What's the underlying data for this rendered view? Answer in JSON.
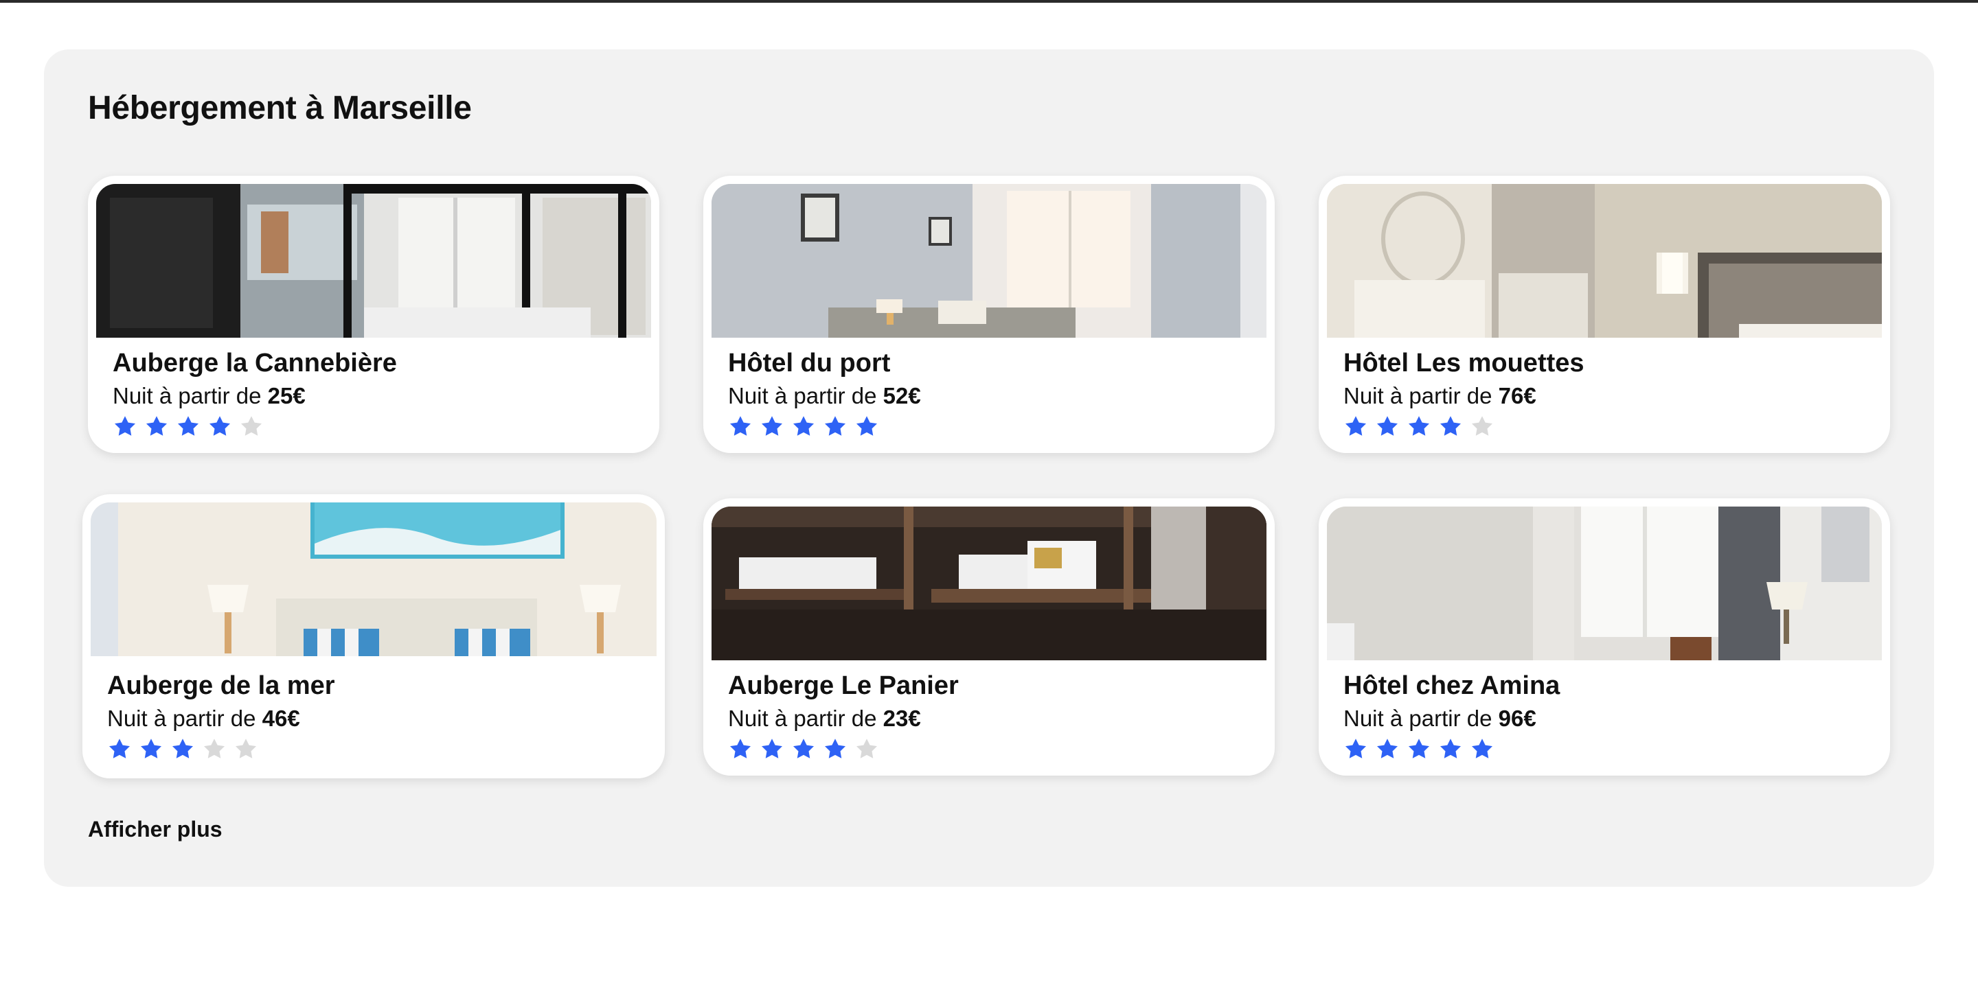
{
  "section": {
    "title": "Hébergement à Marseille",
    "more_label": "Afficher plus"
  },
  "listings": [
    {
      "name": "Auberge la Cannebière",
      "price_prefix": "Nuit à partir de",
      "price": "25€",
      "rating": 4,
      "max_rating": 5,
      "image": "hostel dormitory with bunk bed and window"
    },
    {
      "name": "Hôtel du port",
      "price_prefix": "Nuit à partir de",
      "price": "52€",
      "rating": 5,
      "max_rating": 5,
      "image": "bright room with window and framed pictures"
    },
    {
      "name": "Hôtel Les mouettes",
      "price_prefix": "Nuit à partir de",
      "price": "76€",
      "rating": 4,
      "max_rating": 5,
      "image": "hotel room with mirror and bedside lamp"
    },
    {
      "name": "Auberge de la mer",
      "price_prefix": "Nuit à partir de",
      "price": "46€",
      "rating": 3,
      "max_rating": 5,
      "image": "bedroom with sea wave painting and striped pillows"
    },
    {
      "name": "Auberge Le Panier",
      "price_prefix": "Nuit à partir de",
      "price": "23€",
      "rating": 4,
      "max_rating": 5,
      "image": "wooden bunk beds in a dark dormitory"
    },
    {
      "name": "Hôtel chez Amina",
      "price_prefix": "Nuit à partir de",
      "price": "96€",
      "rating": 5,
      "max_rating": 5,
      "image": "hotel room with window, lamp and chair"
    }
  ],
  "colors": {
    "star_on": "#2e62f5",
    "star_off": "#d9d9d9",
    "panel": "#f2f2f2"
  }
}
